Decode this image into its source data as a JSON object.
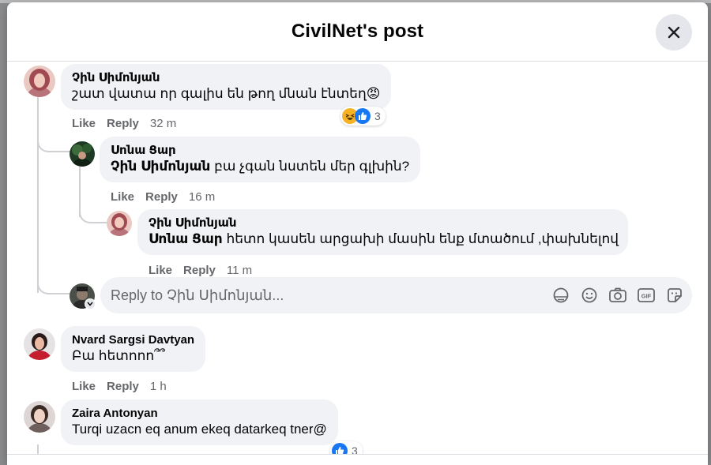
{
  "dialog": {
    "title": "CivilNet's post"
  },
  "comments": [
    {
      "author": "Չին Սիմոնյան",
      "text": "շատ վատա որ գալիս են թող մնան էնտեղ😡",
      "actions": {
        "like": "Like",
        "reply": "Reply",
        "time": "32 m"
      },
      "reactions": {
        "icons": [
          "haha-icon",
          "like-icon"
        ],
        "count": "3"
      },
      "replies": [
        {
          "author": "Սոնա Ցար",
          "mention": "Չին Սիմոնյան",
          "text": "բա չգան նստեն մեր գլխին?",
          "actions": {
            "like": "Like",
            "reply": "Reply",
            "time": "16 m"
          }
        },
        {
          "author": "Չին Սիմոնյան",
          "mention": "Սոնա Ցար",
          "text": "հետո կասեն արցախի մասին ենք մտածում ,փախնելով",
          "actions": {
            "like": "Like",
            "reply": "Reply",
            "time": "11 m"
          }
        }
      ],
      "reply_box": {
        "placeholder": "Reply to Չին Սիմոնյան..."
      }
    },
    {
      "author": "Nvard Sargsi Davtyan",
      "text": "Բա հետոոո՞՞",
      "actions": {
        "like": "Like",
        "reply": "Reply",
        "time": "1 h"
      }
    },
    {
      "author": "Zaira Antonyan",
      "text": "Turqi uzacn eq anum ekeq datarkeq tner@",
      "reactions": {
        "icons": [
          "like-icon"
        ],
        "count": "3"
      }
    }
  ],
  "colors": {
    "like_blue": "#1877f2",
    "haha_yellow": "#f7b125",
    "bubble_bg": "#f0f2f5",
    "meta_gray": "#65676b"
  }
}
